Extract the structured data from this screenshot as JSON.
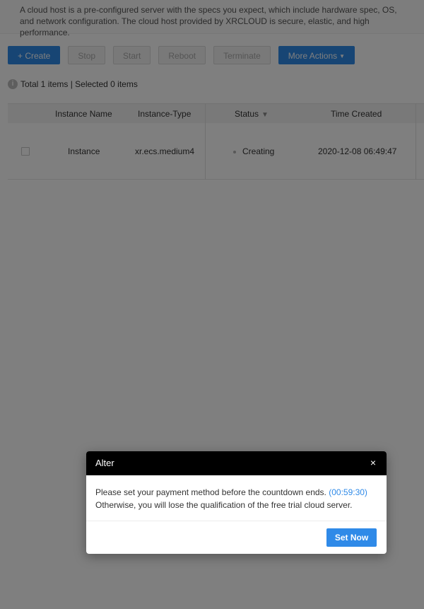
{
  "description": {
    "text": "A cloud host is a pre-configured server with the specs you expect, which include hardware spec, OS, and network configuration. The cloud host provided by XRCLOUD is secure, elastic, and high performance."
  },
  "toolbar": {
    "create_label": "+ Create",
    "stop_label": "Stop",
    "start_label": "Start",
    "reboot_label": "Reboot",
    "terminate_label": "Terminate",
    "more_actions_label": "More Actions"
  },
  "summary": {
    "text": "Total 1 items | Selected 0 items"
  },
  "table": {
    "headers": {
      "instance_name": "Instance Name",
      "instance_type": "Instance-Type",
      "status": "Status",
      "time_created": "Time Created"
    },
    "rows": [
      {
        "instance_name": "Instance",
        "instance_type": "xr.ecs.medium4",
        "status": "Creating",
        "time_created": "2020-12-08 06:49:47"
      }
    ]
  },
  "modal": {
    "title": "Alter",
    "close_glyph": "×",
    "message_line1": "Please set your payment method before the countdown ends. ",
    "countdown": "(00:59:30)",
    "message_line2": "Otherwise, you will lose the qualification of the free trial cloud server.",
    "set_now_label": "Set Now"
  },
  "colors": {
    "accent": "#2f8ae8",
    "overlay": "rgba(0,0,0,0.5)",
    "modal_header": "#000000"
  }
}
